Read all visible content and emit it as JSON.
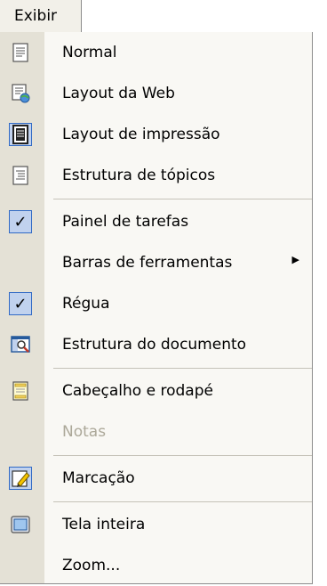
{
  "menubar": {
    "title": "Exibir"
  },
  "menu": {
    "items": [
      {
        "label": "Normal",
        "icon": "normal-view-icon"
      },
      {
        "label": "Layout da Web",
        "icon": "web-layout-icon"
      },
      {
        "label": "Layout de impressão",
        "icon": "print-layout-icon",
        "selected": true
      },
      {
        "label": "Estrutura de tópicos",
        "icon": "outline-view-icon"
      },
      {
        "label": "Painel de tarefas",
        "icon": "checkmark-icon",
        "checked": true
      },
      {
        "label": "Barras de ferramentas",
        "icon": "none",
        "submenu": true
      },
      {
        "label": "Régua",
        "icon": "checkmark-icon",
        "checked": true
      },
      {
        "label": "Estrutura do documento",
        "icon": "document-map-icon"
      },
      {
        "label": "Cabeçalho e rodapé",
        "icon": "header-footer-icon"
      },
      {
        "label": "Notas",
        "icon": "none",
        "disabled": true
      },
      {
        "label": "Marcação",
        "icon": "markup-icon",
        "selected": true
      },
      {
        "label": "Tela inteira",
        "icon": "full-screen-icon"
      },
      {
        "label": "Zoom...",
        "icon": "none"
      }
    ],
    "submenu_arrow": "▶"
  }
}
